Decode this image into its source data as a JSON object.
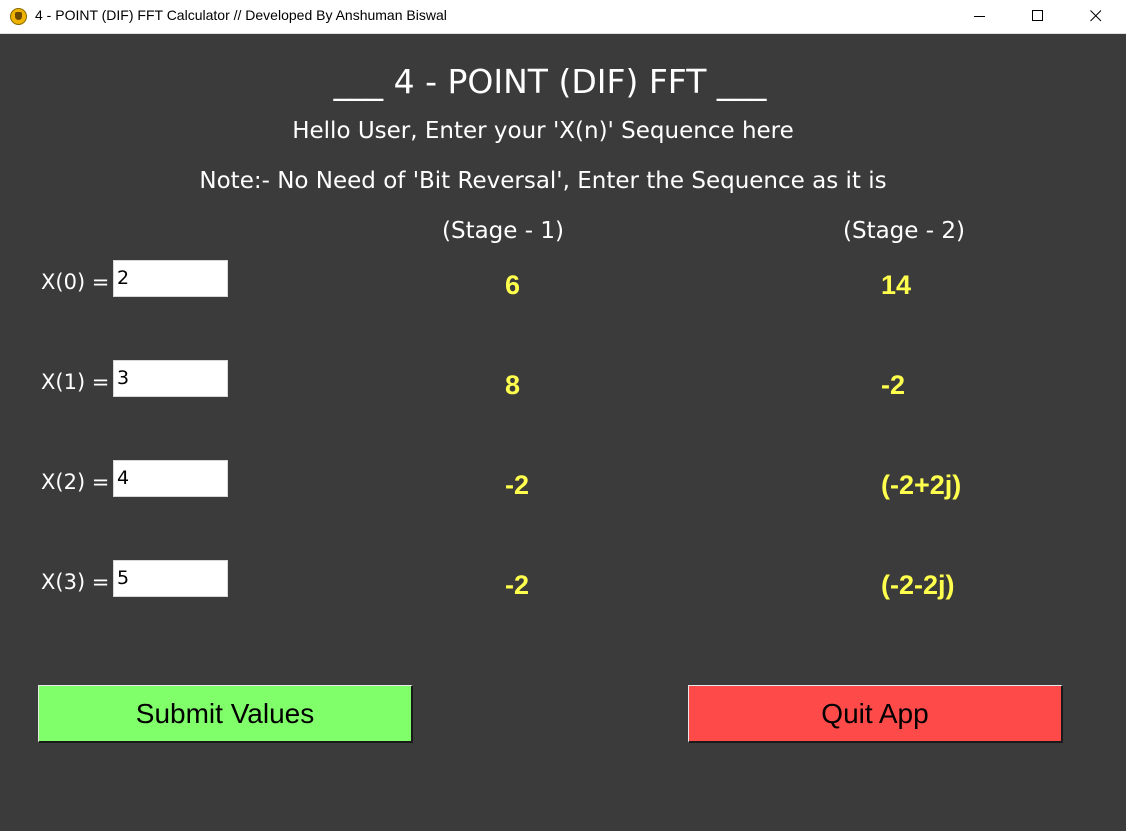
{
  "window": {
    "title": "4 - POINT (DIF) FFT Calculator // Developed By Anshuman Biswal",
    "icon": "app-logo-icon",
    "controls": [
      "minimize-icon",
      "maximize-icon",
      "close-icon"
    ]
  },
  "header": {
    "title": "___ 4 - POINT (DIF) FFT ___",
    "prompt": "Hello User, Enter your 'X(n)' Sequence here",
    "note": "Note:- No Need of  'Bit Reversal', Enter the Sequence as it is"
  },
  "columns": {
    "stage1_label": "(Stage - 1)",
    "stage2_label": "(Stage - 2)"
  },
  "rows": [
    {
      "label": "X(0) =",
      "input_value": "2",
      "stage1": "6",
      "stage2": "14"
    },
    {
      "label": "X(1) =",
      "input_value": "3",
      "stage1": "8",
      "stage2": "-2"
    },
    {
      "label": "X(2) =",
      "input_value": "4",
      "stage1": "-2",
      "stage2": "(-2+2j)"
    },
    {
      "label": "X(3) =",
      "input_value": "5",
      "stage1": "-2",
      "stage2": "(-2-2j)"
    }
  ],
  "buttons": {
    "submit_label": "Submit Values",
    "quit_label": "Quit App"
  },
  "colors": {
    "background": "#3b3b3b",
    "result_text": "#ffff4d",
    "submit_button": "#80ff6a",
    "quit_button": "#ff4a4a"
  }
}
